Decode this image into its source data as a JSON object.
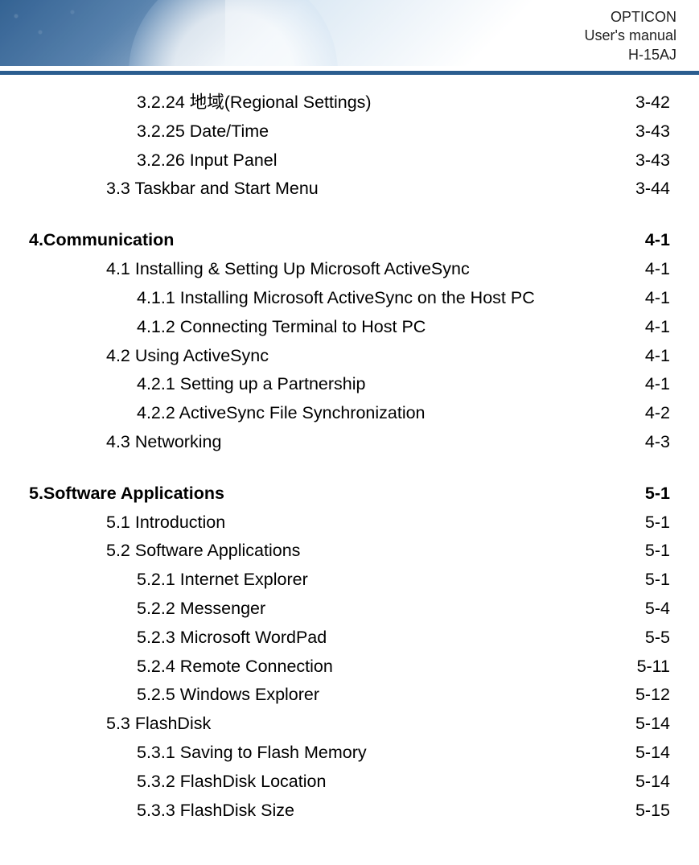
{
  "header": {
    "brand": "OPTICON",
    "subtitle": "User's manual",
    "model": "H-15AJ"
  },
  "toc": [
    {
      "level": 2,
      "label": "3.2.24  地域(Regional Settings) ",
      "page": " 3-42"
    },
    {
      "level": 2,
      "label": "3.2.25 Date/Time ",
      "page": " 3-43"
    },
    {
      "level": 2,
      "label": "3.2.26 Input Panel",
      "page": " 3-43"
    },
    {
      "level": 1,
      "label": "3.3 Taskbar and Start Menu ",
      "page": " 3-44"
    },
    {
      "gap": true
    },
    {
      "level": 0,
      "label": "4.Communication",
      "page": " 4-1"
    },
    {
      "level": 1,
      "label": "4.1 Installing & Setting Up Microsoft ActiveSync ",
      "page": " 4-1"
    },
    {
      "level": 2,
      "label": "4.1.1 Installing Microsoft ActiveSync on the Host PC",
      "page": " 4-1"
    },
    {
      "level": 2,
      "label": "4.1.2 Connecting Terminal to Host PC ",
      "page": " 4-1"
    },
    {
      "level": 1,
      "label": "4.2 Using ActiveSync ",
      "page": " 4-1"
    },
    {
      "level": 2,
      "label": "4.2.1 Setting up a Partnership ",
      "page": " 4-1"
    },
    {
      "level": 2,
      "label": "4.2.2 ActiveSync File Synchronization ",
      "page": " 4-2"
    },
    {
      "level": 1,
      "label": "4.3 Networking ",
      "page": " 4-3"
    },
    {
      "gap": true
    },
    {
      "level": 0,
      "label": "5.Software Applications",
      "page": " 5-1"
    },
    {
      "level": 1,
      "label": "5.1 Introduction ",
      "page": " 5-1"
    },
    {
      "level": 1,
      "label": "5.2 Software Applications ",
      "page": " 5-1"
    },
    {
      "level": 2,
      "label": "5.2.1 Internet Explorer ",
      "page": " 5-1"
    },
    {
      "level": 2,
      "label": "5.2.2 Messenger ",
      "page": " 5-4"
    },
    {
      "level": 2,
      "label": "5.2.3 Microsoft WordPad ",
      "page": " 5-5"
    },
    {
      "level": 2,
      "label": "5.2.4 Remote Connection ",
      "page": "5-11"
    },
    {
      "level": 2,
      "label": "5.2.5 Windows Explorer ",
      "page": " 5-12"
    },
    {
      "level": 1,
      "label": "5.3 FlashDisk ",
      "page": " 5-14"
    },
    {
      "level": 2,
      "label": "5.3.1 Saving to Flash Memory ",
      "page": " 5-14"
    },
    {
      "level": 2,
      "label": "5.3.2 FlashDisk Location",
      "page": " 5-14"
    },
    {
      "level": 2,
      "label": "5.3.3 FlashDisk Size ",
      "page": " 5-15"
    }
  ]
}
